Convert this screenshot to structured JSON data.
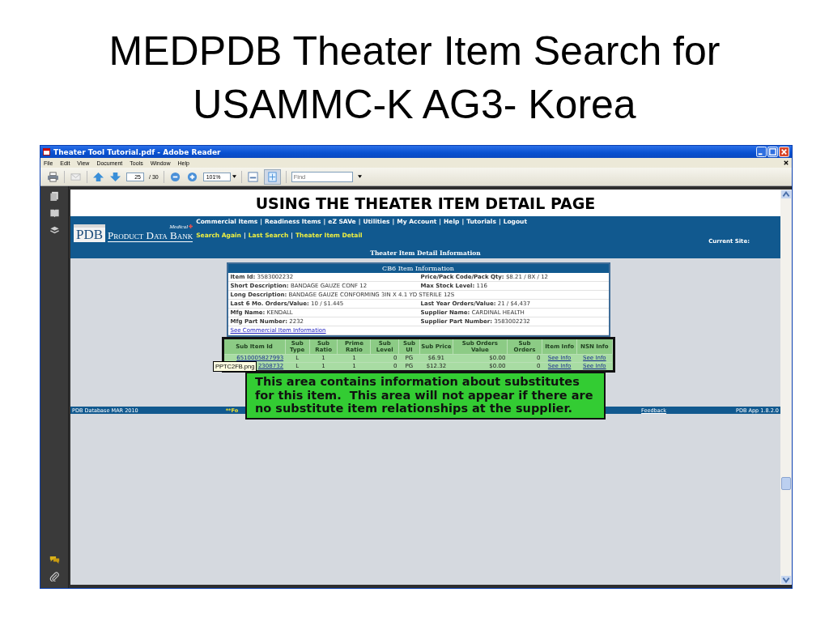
{
  "slide": {
    "title": "MEDPDB Theater Item Search for USAMMC-K AG3- Korea"
  },
  "window": {
    "title": "Theater Tool Tutorial.pdf - Adobe Reader",
    "menu": [
      "File",
      "Edit",
      "View",
      "Document",
      "Tools",
      "Window",
      "Help"
    ],
    "toolbar": {
      "page": "25",
      "page_total": "/ 30",
      "zoom": "101%",
      "find_placeholder": "Find"
    }
  },
  "page": {
    "heading": "USING THE THEATER ITEM DETAIL PAGE",
    "logo": {
      "mark": "PDB",
      "small": "Medical",
      "name": "Product Data Bank"
    },
    "separator": "|",
    "nav_links": [
      "Commercial Items",
      "Readiness Items",
      "eZ SAVe",
      "Utilities",
      "My Account",
      "Help",
      "Tutorials",
      "Logout"
    ],
    "sub_links": [
      "Search Again",
      "Last Search",
      "Theater Item Detail"
    ],
    "current_site": "Current Site:",
    "section_title": "Theater Item Detail Information",
    "item_info": {
      "title": "CB6 Item Information",
      "rows": [
        {
          "fields": [
            "**Item Id:** 3583002232",
            "**Price/Pack Code/Pack Qty:** $8.21 / BX / 12"
          ]
        },
        {
          "fields": [
            "**Short Description:** BANDAGE GAUZE CONF 12",
            "**Max Stock Level:** 116"
          ]
        },
        {
          "fields": [
            "**Long Description:** BANDAGE GAUZE CONFORMING 3IN X 4.1 YD STERILE 12S"
          ]
        },
        {
          "fields": [
            "**Last 6 Mo. Orders/Value:** 10 / $1.445",
            "**Last Year Orders/Value:** 21 / $4,437"
          ]
        },
        {
          "fields": [
            "**Mfg Name:** KENDALL",
            "**Supplier Name:** CARDINAL HEALTH"
          ]
        },
        {
          "fields": [
            "**Mfg Part Number:** 2232",
            "**Supplier Part Number:** 3583002232"
          ]
        }
      ],
      "link": "See Commercial Item Information"
    },
    "substitutes": {
      "columns": [
        "Sub Item Id",
        "Sub Type",
        "Sub Ratio",
        "Prime Ratio",
        "Sub Level",
        "Sub UI",
        "Sub Price",
        "Sub Orders Value",
        "Sub Orders",
        "Item Info",
        "NSN Info"
      ],
      "rows": [
        {
          "cells": [
            {
              "kind": "link",
              "text": "6510005827993"
            },
            {
              "kind": "text",
              "text": "L"
            },
            {
              "kind": "text",
              "text": "1"
            },
            {
              "kind": "text",
              "text": "1"
            },
            {
              "kind": "text",
              "text": "0"
            },
            {
              "kind": "text",
              "text": "PG"
            },
            {
              "kind": "text",
              "text": "$6.91"
            },
            {
              "kind": "text",
              "text": "$0.00"
            },
            {
              "kind": "text",
              "text": "0"
            },
            {
              "kind": "link",
              "text": "See Info"
            },
            {
              "kind": "link",
              "text": "See Info"
            }
          ]
        },
        {
          "cells": [
            {
              "kind": "link",
              "text": "2308732"
            },
            {
              "kind": "text",
              "text": "L"
            },
            {
              "kind": "text",
              "text": "1"
            },
            {
              "kind": "text",
              "text": "1"
            },
            {
              "kind": "text",
              "text": "0"
            },
            {
              "kind": "text",
              "text": "PG"
            },
            {
              "kind": "text",
              "text": "$12.32"
            },
            {
              "kind": "text",
              "text": "$0.00"
            },
            {
              "kind": "text",
              "text": "0"
            },
            {
              "kind": "link",
              "text": "See Info"
            },
            {
              "kind": "link",
              "text": "See Info"
            }
          ]
        }
      ]
    },
    "footer": {
      "database": "PDB Database MAR 2010",
      "notice": "**Fo",
      "feedback": "Feedback",
      "version": "PDB App 1.8.2.0"
    },
    "tooltip": "PPTC2FB.png",
    "callout": "This area contains information about substitutes for this item.  This area will not appear if there are no substitute item relationships at the supplier."
  }
}
